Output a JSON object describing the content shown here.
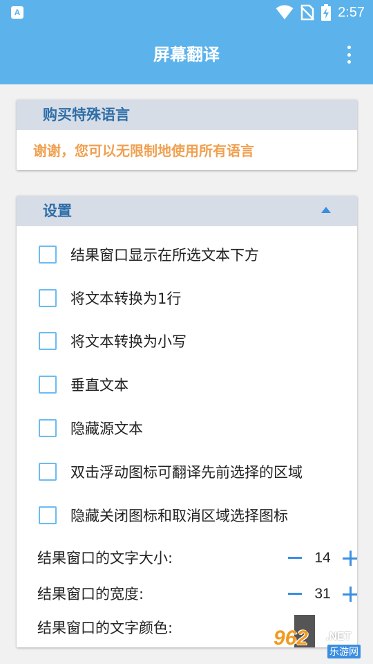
{
  "status_bar": {
    "time": "2:57",
    "app_icon_letter": "A",
    "icons": [
      "wifi-icon",
      "no-sim-icon",
      "battery-charging-icon"
    ]
  },
  "app_bar": {
    "title": "屏幕翻译",
    "menu_icon": "more-vert-icon"
  },
  "purchase_card": {
    "header": "购买特殊语言",
    "message": "谢谢，您可以无限制地使用所有语言"
  },
  "settings_card": {
    "header": "设置",
    "collapse_icon": "chevron-up-icon",
    "options": [
      {
        "label": "结果窗口显示在所选文本下方",
        "checked": false
      },
      {
        "label": "将文本转换为1行",
        "checked": false
      },
      {
        "label": "将文本转换为小写",
        "checked": false
      },
      {
        "label": "垂直文本",
        "checked": false
      },
      {
        "label": "隐藏源文本",
        "checked": false
      },
      {
        "label": "双击浮动图标可翻译先前选择的区域",
        "checked": false
      },
      {
        "label": "隐藏关闭图标和取消区域选择图标",
        "checked": false
      }
    ],
    "font_size": {
      "label": "结果窗口的文字大小:",
      "value": "14"
    },
    "width": {
      "label": "结果窗口的宽度:",
      "value": "31"
    },
    "text_color": {
      "label": "结果窗口的文字颜色:",
      "color": "#555555"
    }
  },
  "watermark": {
    "number": "962",
    "suffix": ".NET",
    "subtitle": "乐游网"
  },
  "colors": {
    "primary": "#5cb3ec",
    "accent": "#3a8ee0",
    "header_bg": "#d7dde7",
    "highlight_text": "#f0a050"
  }
}
